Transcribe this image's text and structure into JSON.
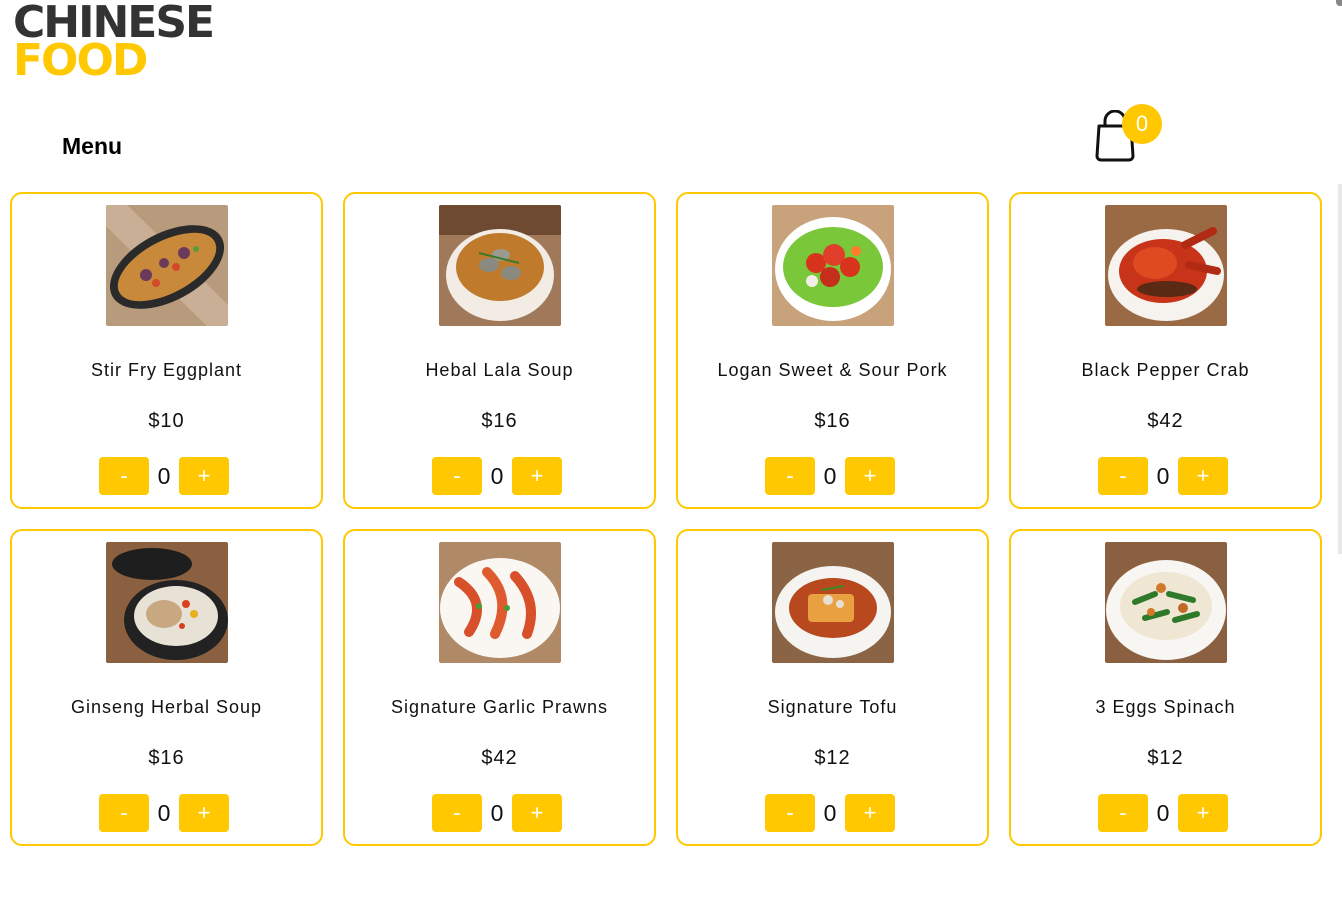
{
  "brand": {
    "line1": "CHINESE",
    "line2": "FOOD"
  },
  "menu_title": "Menu",
  "cart": {
    "count": "0",
    "icon": "shopping-bag-icon"
  },
  "colors": {
    "accent": "#ffc800",
    "logo_dark": "#333333"
  },
  "items": [
    {
      "name": "Stir Fry Eggplant",
      "price": "$10",
      "qty": "0",
      "minus": "-",
      "plus": "+",
      "image": "stir-fry-eggplant-photo"
    },
    {
      "name": "Hebal Lala Soup",
      "price": "$16",
      "qty": "0",
      "minus": "-",
      "plus": "+",
      "image": "herbal-lala-soup-photo"
    },
    {
      "name": "Logan Sweet & Sour Pork",
      "price": "$16",
      "qty": "0",
      "minus": "-",
      "plus": "+",
      "image": "sweet-sour-pork-photo"
    },
    {
      "name": "Black Pepper Crab",
      "price": "$42",
      "qty": "0",
      "minus": "-",
      "plus": "+",
      "image": "black-pepper-crab-photo"
    },
    {
      "name": "Ginseng Herbal Soup",
      "price": "$16",
      "qty": "0",
      "minus": "-",
      "plus": "+",
      "image": "ginseng-herbal-soup-photo"
    },
    {
      "name": "Signature Garlic Prawns",
      "price": "$42",
      "qty": "0",
      "minus": "-",
      "plus": "+",
      "image": "garlic-prawns-photo"
    },
    {
      "name": "Signature Tofu",
      "price": "$12",
      "qty": "0",
      "minus": "-",
      "plus": "+",
      "image": "signature-tofu-photo"
    },
    {
      "name": "3 Eggs Spinach",
      "price": "$12",
      "qty": "0",
      "minus": "-",
      "plus": "+",
      "image": "three-eggs-spinach-photo"
    }
  ]
}
